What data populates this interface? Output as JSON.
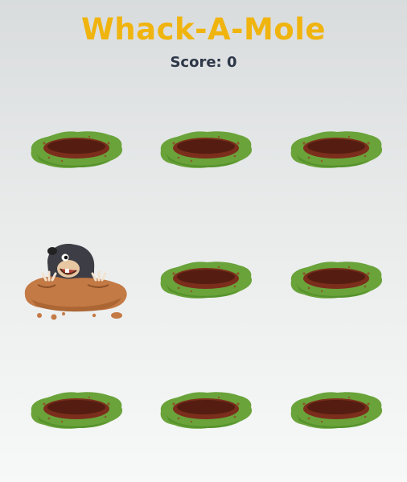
{
  "game": {
    "title": "Whack-A-Mole",
    "score_label": "Score: 0",
    "score": 0
  },
  "colors": {
    "title": "#f0b40f",
    "score_text": "#2d3748",
    "grass": "#6aa33a",
    "grass_dark": "#4e8a27",
    "hole": "#7b2e1c",
    "hole_dark": "#4f1a0f",
    "dirt": "#c47a45",
    "mole": "#3d3d45"
  },
  "board": {
    "rows": 3,
    "cols": 3,
    "holes": [
      {
        "id": 1,
        "state": "hole"
      },
      {
        "id": 2,
        "state": "hole"
      },
      {
        "id": 3,
        "state": "hole"
      },
      {
        "id": 4,
        "state": "mole"
      },
      {
        "id": 5,
        "state": "hole"
      },
      {
        "id": 6,
        "state": "hole"
      },
      {
        "id": 7,
        "state": "hole"
      },
      {
        "id": 8,
        "state": "hole"
      },
      {
        "id": 9,
        "state": "hole"
      }
    ]
  }
}
